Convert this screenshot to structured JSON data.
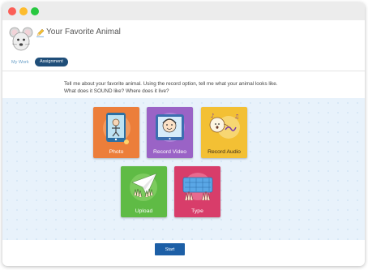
{
  "header": {
    "title": "Your Favorite Animal",
    "tabs": [
      {
        "label": "My Work"
      },
      {
        "label": "Assignment"
      }
    ]
  },
  "prompt": "Tell me about your favorite animal.  Using the record option, tell me what your animal looks like.  What does it SOUND like?  Where does it live?",
  "options": [
    {
      "label": "Photo",
      "icon": "photo-icon",
      "color": "#ec7e3a"
    },
    {
      "label": "Record Video",
      "icon": "video-icon",
      "color": "#9a63c6"
    },
    {
      "label": "Record Audio",
      "icon": "audio-icon",
      "color": "#f3c034"
    },
    {
      "label": "Upload",
      "icon": "upload-icon",
      "color": "#5fbb45"
    },
    {
      "label": "Type",
      "icon": "keyboard-icon",
      "color": "#d83d6a"
    }
  ],
  "start_label": "Start",
  "colors": {
    "accent": "#1d5fa6",
    "active_tab": "#1f4e79",
    "content_bg": "#e8f2fb"
  }
}
